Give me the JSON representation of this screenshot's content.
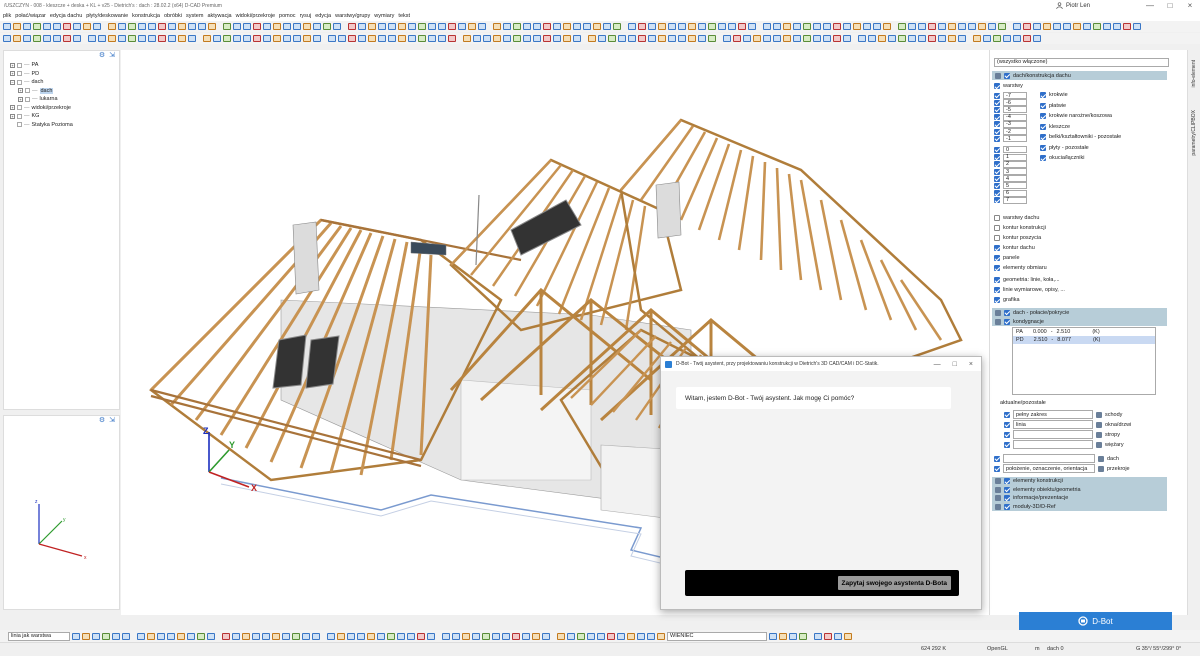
{
  "window": {
    "title": "/USZCZYN - 008 - kleszcze + deska + KL + v25 - Dietrich's : dach : 28.02.2 (x64)      D-CAD Premium",
    "user": "Piotr Len",
    "minimize": "—",
    "maximize": "□",
    "close": "×"
  },
  "menu": [
    "plik",
    "połać/wiązar",
    "edycja dachu",
    "płyty/deskowanie",
    "konstrukcja",
    "obróbki",
    "system",
    "aktywacja",
    "widoki/przekroje",
    "pomoc",
    "rysuj",
    "edycja",
    "warstwy/grupy",
    "wymiary",
    "tekst"
  ],
  "tree": {
    "items": [
      {
        "label": "PA",
        "sym": "+",
        "indent": 0
      },
      {
        "label": "PD",
        "sym": "+",
        "indent": 0
      },
      {
        "label": "dach",
        "sym": "−",
        "indent": 0
      },
      {
        "label": "dach",
        "sym": "+",
        "indent": 1,
        "selected": true
      },
      {
        "label": "lukarna",
        "sym": "+",
        "indent": 1
      },
      {
        "label": "widoki/przekroje",
        "sym": "+",
        "indent": 0
      },
      {
        "label": "KG",
        "sym": "+",
        "indent": 0
      },
      {
        "label": "Statyka Pozioma",
        "sym": "",
        "indent": 0
      }
    ]
  },
  "viewport_axes": {
    "z": "Z",
    "y": "Y",
    "x": "X"
  },
  "mini_axes": {
    "z": "z",
    "y": "y",
    "x": "x"
  },
  "right_panel": {
    "filter": "(wszystko włączone)",
    "group_header": "dach/konstrukcja dachu",
    "warstwy_label": "warstwy",
    "layer_numbers": [
      "-7",
      "-6",
      "-5",
      "-4",
      "-3",
      "-2",
      "-1",
      "0",
      "1",
      "2",
      "3",
      "4",
      "5",
      "6",
      "7"
    ],
    "layer_types": [
      "krokwie",
      "płatwie",
      "krokwie narożne/koszowa",
      "kleszcze",
      "belki/kształtowniki - pozostałe",
      "płyty - pozostałe",
      "okucia/łączniki"
    ],
    "options": [
      {
        "label": "warstwy dachu",
        "checked": false
      },
      {
        "label": "kontur konstrukcji",
        "checked": false
      },
      {
        "label": "kontur poszycia",
        "checked": false
      },
      {
        "label": "kontur dachu",
        "checked": true
      },
      {
        "label": "panele",
        "checked": true
      },
      {
        "label": "elementy obmiaru",
        "checked": true
      }
    ],
    "geometry": [
      {
        "label": "geometria: linie, koła,...",
        "checked": true
      },
      {
        "label": "linie wymiarowe, opisy, ...",
        "checked": true
      },
      {
        "label": "grafika",
        "checked": true
      }
    ],
    "sec_dach": "dach - połacie/pokrycie",
    "sec_kond": "kondygnacje",
    "storeys": [
      {
        "name": "PA",
        "from": "0.000",
        "sep": "-",
        "to": "2.510",
        "unit": "(K)"
      },
      {
        "name": "PD",
        "from": "2.510",
        "sep": "-",
        "to": "8.077",
        "unit": "(K)"
      }
    ],
    "aktualne_label": "aktualne/pozostałe",
    "aktualne": [
      {
        "value": "pełny zakres",
        "label": "schody"
      },
      {
        "value": "linia",
        "label": "okna/drzwi"
      },
      {
        "value": "",
        "label": "stropy"
      },
      {
        "value": "",
        "label": "więźary"
      }
    ],
    "dach_row": "dach",
    "polozenie": "położenie, oznaczenie, orientacja",
    "przekroje": "przekroje",
    "bottom_groups": [
      "elementy konstrukcji",
      "elementy obiektu/geometria",
      "informacje/prezentacje",
      "moduły-3D/D-Ref"
    ]
  },
  "side_tabs": {
    "a": "info-element",
    "b": "parametry/CLIPBOX"
  },
  "dialog": {
    "title": "D-Bot - Twój asystent, przy projektowaniu konstrukcji w Dietrich's 3D CAD/CAM i DC-Statik.",
    "greeting": "Witam, jestem D-Bot - Twój asystent. Jak mogę Ci pomóc?",
    "send": "Zapytaj swojego asystenta D-Bota"
  },
  "dbot_tab": "D-Bot",
  "bottom": {
    "line_mode": "linia jak warstwa",
    "layer": "WIENIEC"
  },
  "status": {
    "mem": "624 292 K",
    "renderer": "OpenGL",
    "unit": "m",
    "layer": "dach 0",
    "angles": "G 35°/ 55°/299°  0°"
  }
}
